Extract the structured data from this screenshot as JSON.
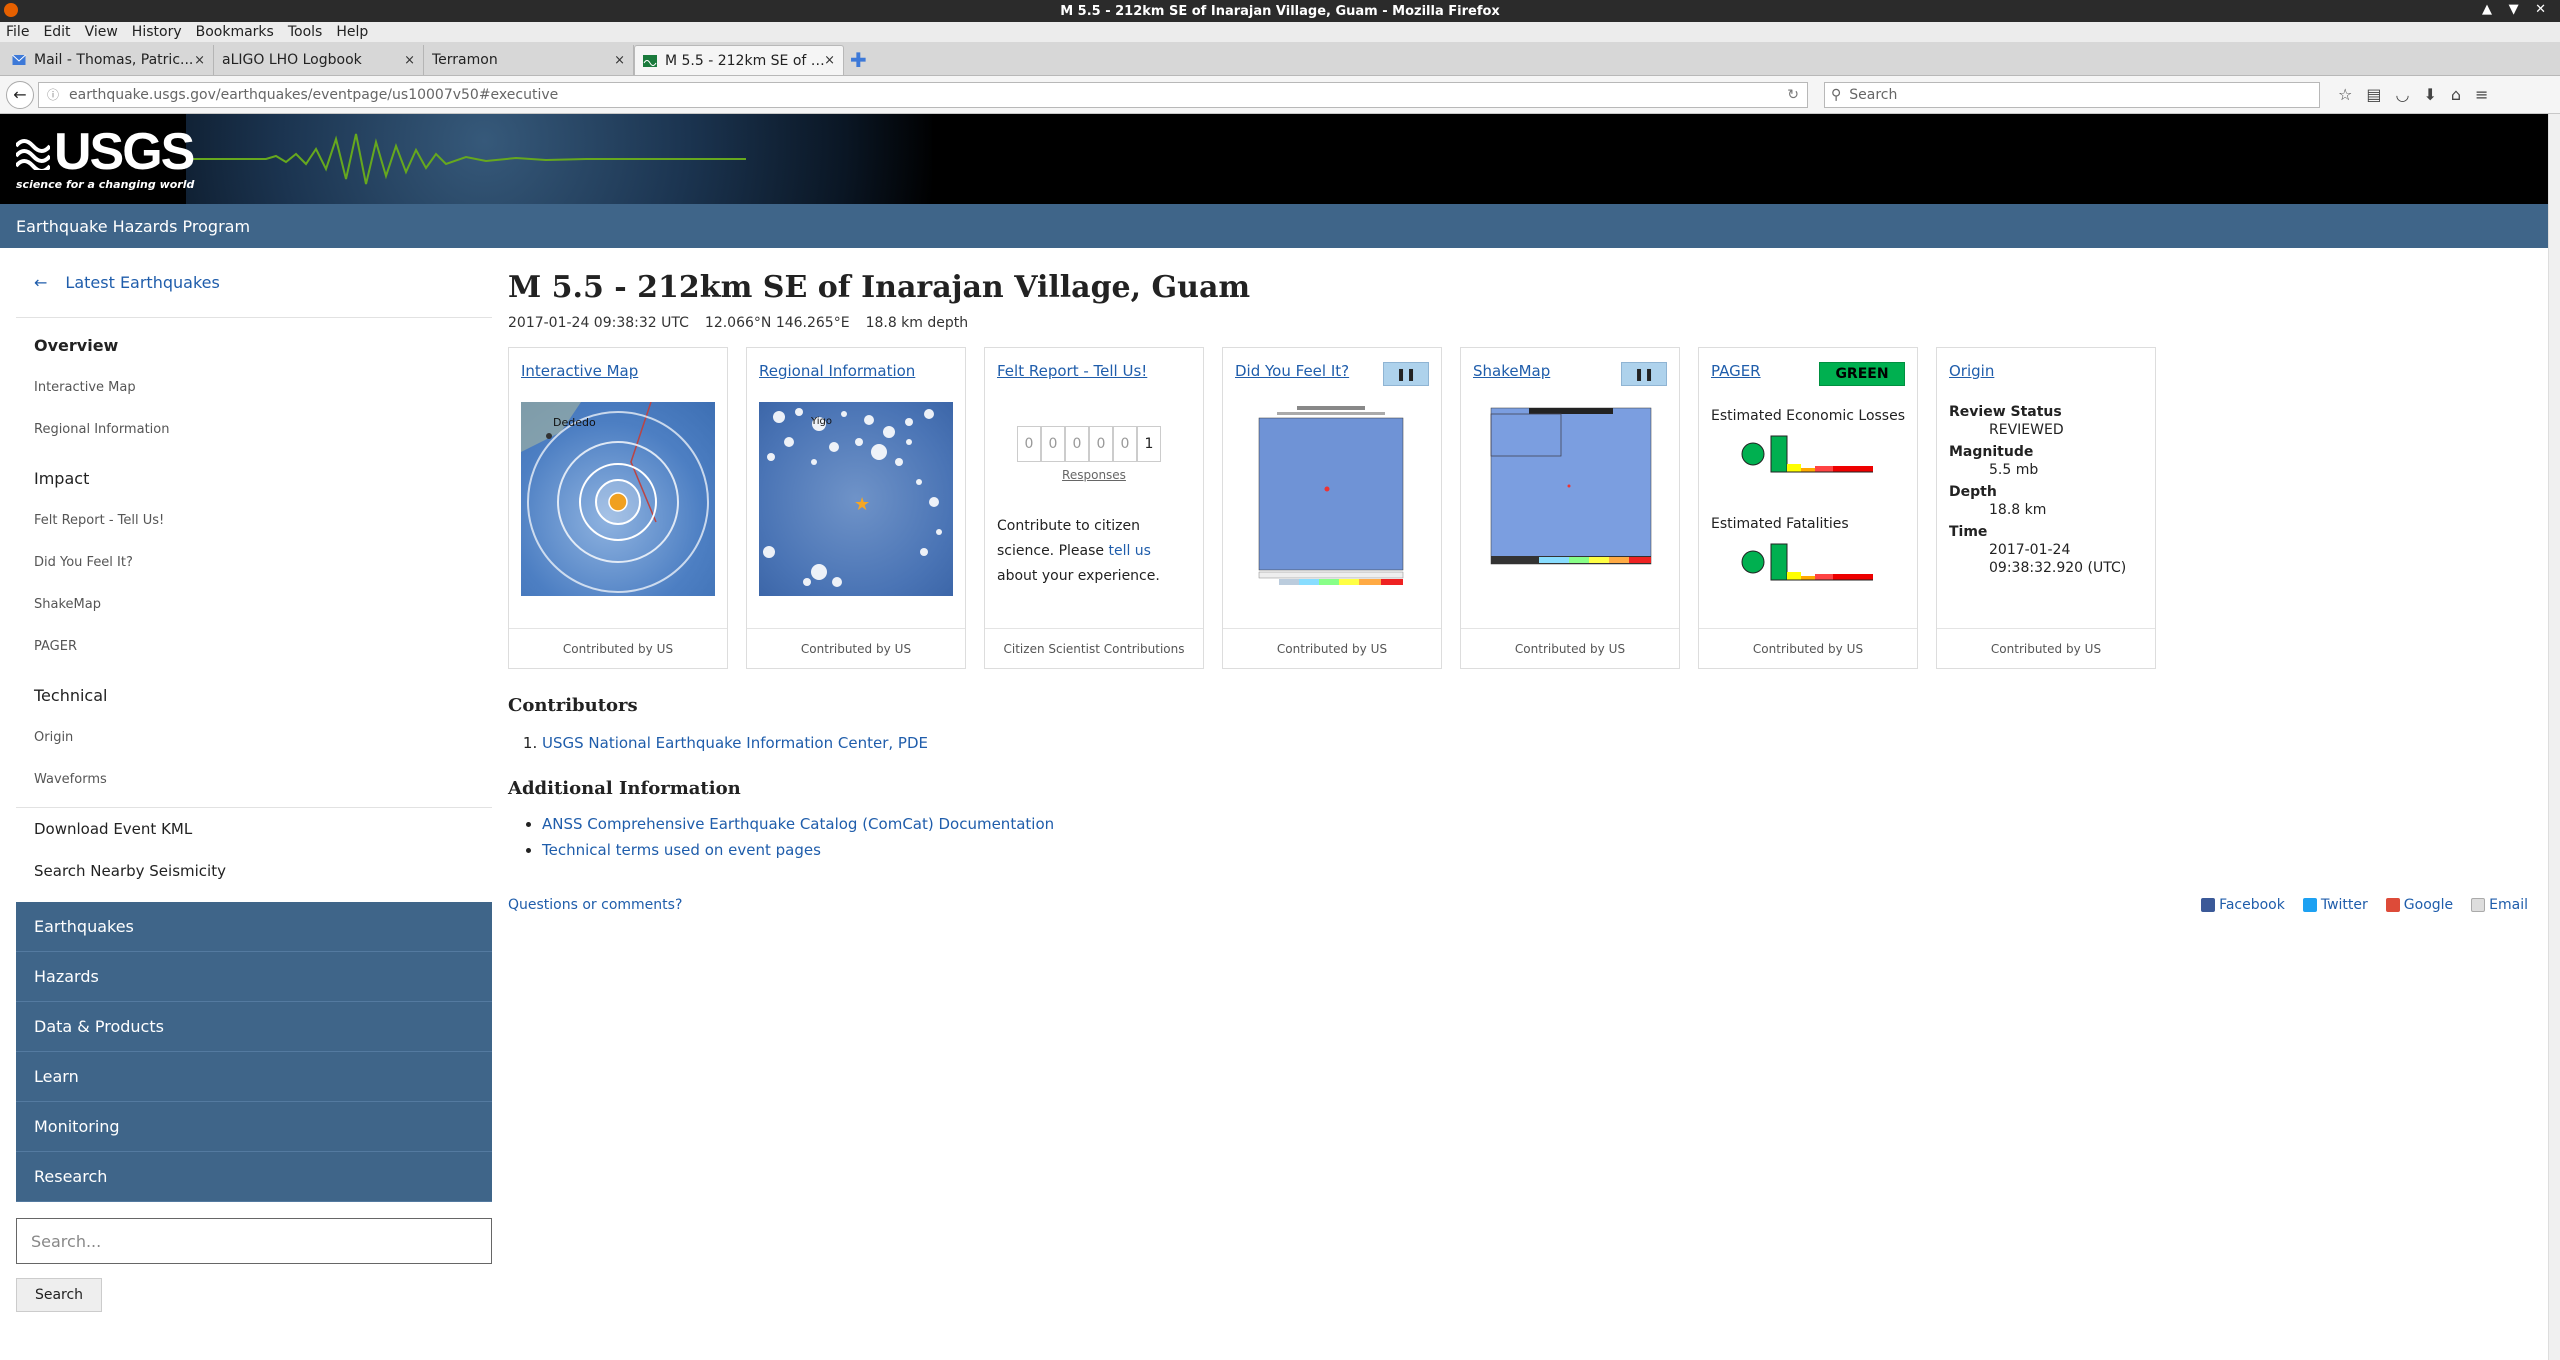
{
  "window": {
    "title": "M 5.5 - 212km SE of Inarajan Village, Guam - Mozilla Firefox",
    "controls": "▲ ▼ ✕"
  },
  "menu": [
    "File",
    "Edit",
    "View",
    "History",
    "Bookmarks",
    "Tools",
    "Help"
  ],
  "tabs": [
    {
      "label": "Mail - Thomas, Patric...",
      "close": "×"
    },
    {
      "label": "aLIGO LHO Logbook",
      "close": "×"
    },
    {
      "label": "Terramon",
      "close": "×"
    },
    {
      "label": "M 5.5 - 212km SE of I...",
      "close": "×"
    }
  ],
  "newtab": "✚",
  "url": "earthquake.usgs.gov/earthquakes/eventpage/us10007v50#executive",
  "search_placeholder": "Search",
  "logo": {
    "word": "USGS",
    "tagline": "science for a changing world"
  },
  "program": "Earthquake Hazards Program",
  "sidebar": {
    "back_arrow": "←",
    "back": "Latest Earthquakes",
    "overview": "Overview",
    "overview_items": [
      "Interactive Map",
      "Regional Information"
    ],
    "impact": "Impact",
    "impact_items": [
      "Felt Report - Tell Us!",
      "Did You Feel It?",
      "ShakeMap",
      "PAGER"
    ],
    "technical": "Technical",
    "technical_items": [
      "Origin",
      "Waveforms"
    ],
    "download": "Download Event KML",
    "nearby": "Search Nearby Seismicity",
    "site_nav": [
      "Earthquakes",
      "Hazards",
      "Data & Products",
      "Learn",
      "Monitoring",
      "Research"
    ],
    "search_placeholder": "Search...",
    "search_button": "Search"
  },
  "event": {
    "title": "M 5.5 - 212km SE of Inarajan Village, Guam",
    "time": "2017-01-24 09:38:32 UTC",
    "location": "12.066°N  146.265°E",
    "depth": "18.8 km depth"
  },
  "cards": {
    "interactive_map": {
      "title": "Interactive Map",
      "map_label": "Dededo",
      "contrib": "Contributed by",
      "net": "US"
    },
    "regional": {
      "title": "Regional Information",
      "map_label": "Yigo",
      "contrib": "Contributed by",
      "net": "US"
    },
    "felt": {
      "title": "Felt Report - Tell Us!",
      "digits": [
        "0",
        "0",
        "0",
        "0",
        "0",
        "1"
      ],
      "responses": "Responses",
      "text1": "Contribute to citizen science. Please ",
      "link": "tell us",
      "text2": " about your experience.",
      "contrib": "Citizen Scientist Contributions"
    },
    "dyfi": {
      "title": "Did You Feel It?",
      "pause": "❚❚",
      "contrib": "Contributed by",
      "net": "US"
    },
    "shakemap": {
      "title": "ShakeMap",
      "pause": "❚❚",
      "contrib": "Contributed by",
      "net": "US"
    },
    "pager": {
      "title": "PAGER",
      "alert": "GREEN",
      "losses": "Estimated Economic Losses",
      "fatalities": "Estimated Fatalities",
      "contrib": "Contributed by",
      "net": "US"
    },
    "origin": {
      "title": "Origin",
      "review_label": "Review Status",
      "review": "REVIEWED",
      "mag_label": "Magnitude",
      "mag": "5.5 mb",
      "depth_label": "Depth",
      "depth": "18.8 km",
      "time_label": "Time",
      "date": "2017-01-24",
      "time": "09:38:32.920 (UTC)",
      "contrib": "Contributed by",
      "net": "US"
    }
  },
  "contributors": {
    "heading": "Contributors",
    "items": [
      "USGS National Earthquake Information Center, PDE"
    ]
  },
  "additional": {
    "heading": "Additional Information",
    "items": [
      "ANSS Comprehensive Earthquake Catalog (ComCat) Documentation",
      "Technical terms used on event pages"
    ]
  },
  "footer": {
    "questions": "Questions or comments?",
    "share": [
      "Facebook",
      "Twitter",
      "Google",
      "Email"
    ]
  }
}
